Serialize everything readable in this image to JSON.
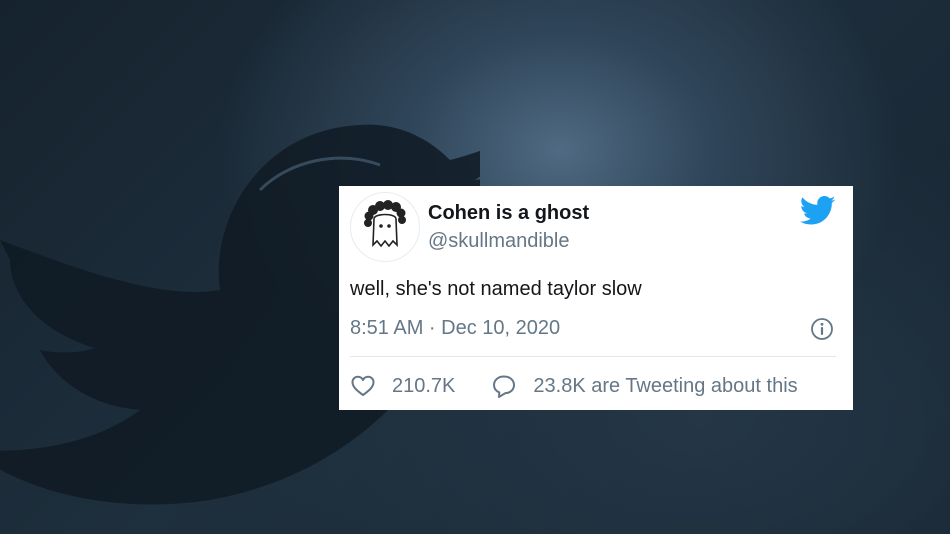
{
  "tweet": {
    "display_name": "Cohen is a ghost",
    "handle": "@skullmandible",
    "text": "well, she's not named taylor slow",
    "timestamp": "8:51 AM · Dec 10, 2020",
    "likes": "210.7K",
    "replies_label": "23.8K are Tweeting about this"
  },
  "icons": {
    "brand": "twitter-bird-icon",
    "info": "info-icon",
    "like": "heart-icon",
    "reply": "speech-bubble-icon",
    "avatar": "ghost-avatar"
  },
  "colors": {
    "brand_blue": "#1da1f2",
    "text_primary": "#14171a",
    "text_secondary": "#657786",
    "divider": "#e1e8ed",
    "background": "#1b2936"
  }
}
